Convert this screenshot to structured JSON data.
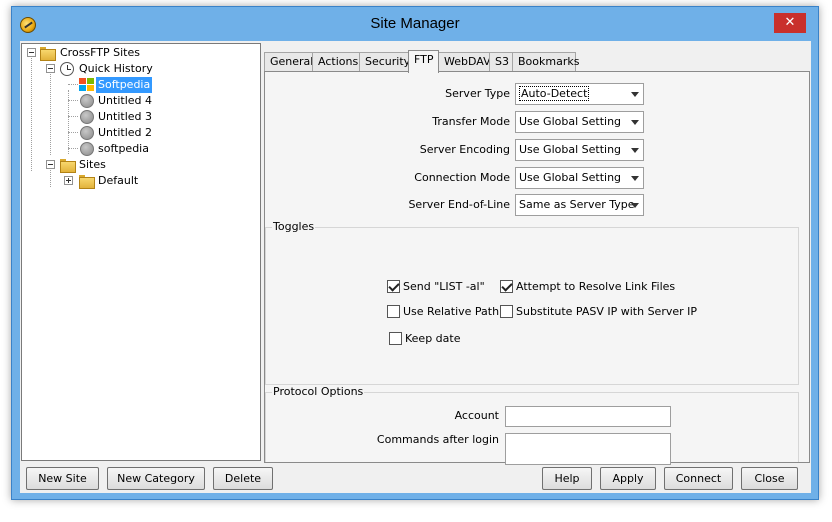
{
  "window": {
    "title": "Site Manager",
    "close_glyph": "✕"
  },
  "tree": {
    "nodes": [
      {
        "label": "CrossFTP Sites",
        "icon": "folder-icon"
      },
      {
        "label": "Quick History",
        "icon": "clock-icon"
      },
      {
        "label": "Softpedia",
        "icon": "windows-site-icon",
        "selected": true
      },
      {
        "label": "Untitled 4",
        "icon": "site-icon"
      },
      {
        "label": "Untitled 3",
        "icon": "site-icon"
      },
      {
        "label": "Untitled 2",
        "icon": "site-icon"
      },
      {
        "label": "softpedia",
        "icon": "site-icon"
      },
      {
        "label": "Sites",
        "icon": "folder-icon"
      },
      {
        "label": "Default",
        "icon": "folder-icon"
      }
    ]
  },
  "tabs": [
    "General",
    "Actions",
    "Security",
    "FTP",
    "WebDAV",
    "S3",
    "Bookmarks"
  ],
  "active_tab": "FTP",
  "ftp": {
    "server_type": {
      "label": "Server Type",
      "value": "Auto-Detect"
    },
    "transfer_mode": {
      "label": "Transfer Mode",
      "value": "Use Global Setting"
    },
    "server_encoding": {
      "label": "Server Encoding",
      "value": "Use Global Setting"
    },
    "connection_mode": {
      "label": "Connection Mode",
      "value": "Use Global Setting"
    },
    "server_eol": {
      "label": "Server End-of-Line",
      "value": "Same as Server Type"
    }
  },
  "toggles": {
    "title": "Toggles",
    "send_list": {
      "label": "Send \"LIST -al\"",
      "checked": true
    },
    "resolve_links": {
      "label": "Attempt to Resolve Link Files",
      "checked": true
    },
    "relative_path": {
      "label": "Use Relative Path",
      "checked": false
    },
    "substitute_pasv": {
      "label": "Substitute PASV IP with Server IP",
      "checked": false
    },
    "keep_date": {
      "label": "Keep date",
      "checked": false
    }
  },
  "protocol": {
    "title": "Protocol Options",
    "account_label": "Account",
    "account_value": "",
    "commands_label": "Commands after login",
    "commands_value": ""
  },
  "buttons": {
    "new_site": "New Site",
    "new_category": "New Category",
    "delete": "Delete",
    "help": "Help",
    "apply": "Apply",
    "connect": "Connect",
    "close": "Close"
  },
  "colors": {
    "titlebar": "#6fb0e8",
    "close_button": "#c9302c",
    "selection": "#3399ff"
  }
}
